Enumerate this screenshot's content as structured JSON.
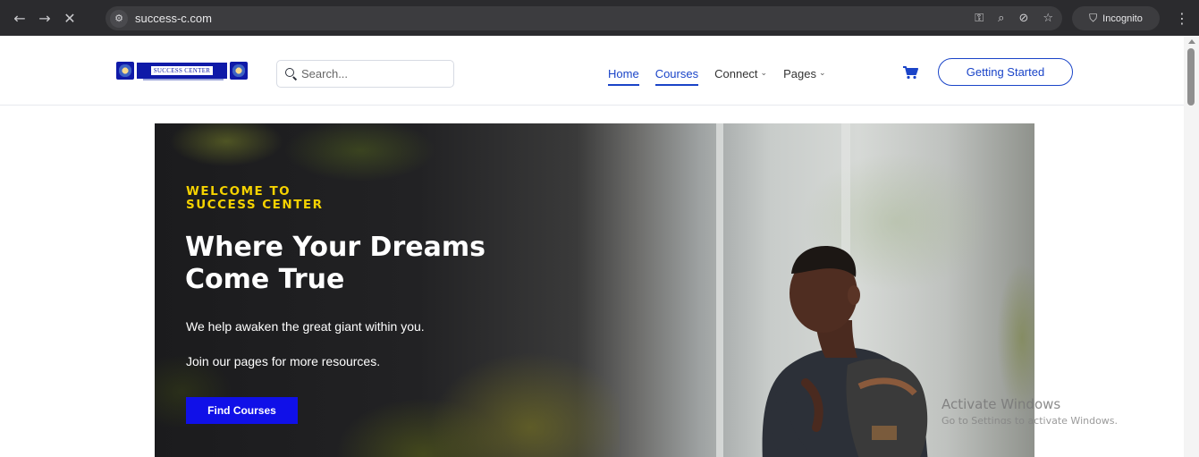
{
  "browser": {
    "back_glyph": "←",
    "forward_glyph": "→",
    "close_glyph": "✕",
    "site_info_glyph": "⚙",
    "url": "success-c.com",
    "omnibox_icons": [
      "key-icon",
      "zoom-icon",
      "eye-off-icon",
      "star-icon"
    ],
    "key_glyph": "⚿",
    "zoom_glyph": "⌕",
    "eye_off_glyph": "⊘",
    "star_glyph": "☆",
    "incognito_glyph": "⛉",
    "incognito_label": "Incognito",
    "menu_glyph": "⋮"
  },
  "header": {
    "logo_text": "SUCCESS CENTER",
    "search_placeholder": "Search...",
    "nav": [
      {
        "label": "Home",
        "active": true
      },
      {
        "label": "Courses",
        "active": true
      },
      {
        "label": "Connect",
        "dropdown": true
      },
      {
        "label": "Pages",
        "dropdown": true
      }
    ],
    "dropdown_glyph": "⌄",
    "cta_label": "Getting Started"
  },
  "hero": {
    "eyebrow_line1": "WELCOME TO",
    "eyebrow_line2": "SUCCESS CENTER",
    "title_line1": "Where Your Dreams",
    "title_line2": "Come True",
    "subtitle1": "We help awaken the great giant within you.",
    "subtitle2": "Join our pages for more resources.",
    "button_label": "Find Courses"
  },
  "overlay": {
    "line1": "Activate Windows",
    "line2": "Go to Settings to activate Windows."
  },
  "colors": {
    "accent": "#1a44c8",
    "eyebrow": "#f5d200",
    "find_button": "#1010e8",
    "chrome_bg": "#2b2b2e"
  }
}
